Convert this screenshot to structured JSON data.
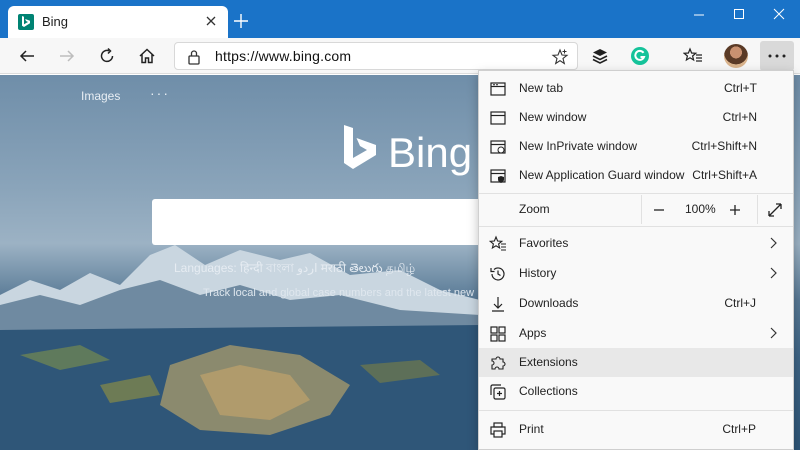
{
  "tab": {
    "title": "Bing"
  },
  "address": {
    "url": "https://www.bing.com"
  },
  "page": {
    "nav_images": "Images",
    "nav_more": "···",
    "logo_text": "Bing",
    "languages": "Languages: हिन्दी বাংলা اردو मराठी తెలుగు தமிழ்",
    "news": "Track local and global case numbers and the latest new"
  },
  "menu": {
    "items": [
      {
        "label": "New tab",
        "shortcut": "Ctrl+T",
        "icon": "new-tab-icon"
      },
      {
        "label": "New window",
        "shortcut": "Ctrl+N",
        "icon": "window-icon"
      },
      {
        "label": "New InPrivate window",
        "shortcut": "Ctrl+Shift+N",
        "icon": "inprivate-icon"
      },
      {
        "label": "New Application Guard window",
        "shortcut": "Ctrl+Shift+A",
        "icon": "app-guard-icon"
      }
    ],
    "zoom": {
      "label": "Zoom",
      "minus": "−",
      "value": "100%",
      "plus": "+"
    },
    "items2": [
      {
        "label": "Favorites",
        "icon": "favorites-icon",
        "submenu": true
      },
      {
        "label": "History",
        "icon": "history-icon",
        "submenu": true
      },
      {
        "label": "Downloads",
        "shortcut": "Ctrl+J",
        "icon": "download-icon"
      },
      {
        "label": "Apps",
        "icon": "apps-icon",
        "submenu": true
      },
      {
        "label": "Extensions",
        "icon": "extensions-icon"
      },
      {
        "label": "Collections",
        "icon": "collections-icon"
      }
    ],
    "print": {
      "label": "Print",
      "shortcut": "Ctrl+P",
      "icon": "print-icon"
    }
  },
  "colors": {
    "titlebar": "#1a73c8",
    "bing_favicon": "#008373",
    "grammarly": "#15c39a"
  }
}
